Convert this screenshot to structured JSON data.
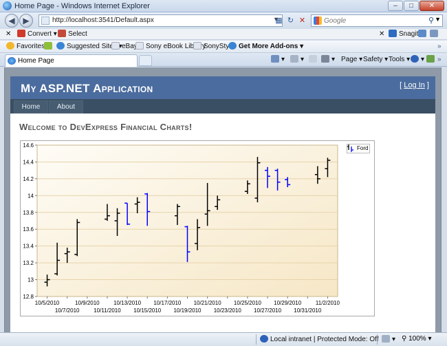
{
  "window": {
    "title": "Home Page - Windows Internet Explorer",
    "min_icon": "minimize-icon",
    "max_icon": "maximize-icon",
    "close_icon": "close-icon"
  },
  "nav": {
    "url": "http://localhost:3541/Default.aspx",
    "search_placeholder": "Google"
  },
  "command_bar": {
    "convert": "Convert",
    "select": "Select",
    "snagit": "Snagit"
  },
  "links_bar": {
    "favorites": "Favorites",
    "suggested_sites": "Suggested Sites",
    "ebay": "eBay",
    "sony_library": "Sony eBook Library",
    "sonystyle": "SonyStyle",
    "addons": "Get More Add-ons"
  },
  "tabs": {
    "active": "Home Page"
  },
  "toolbar": {
    "page": "Page",
    "safety": "Safety",
    "tools": "Tools"
  },
  "site": {
    "title": "My ASP.NET Application",
    "login_open": "[ ",
    "login_link": "Log In",
    "login_close": " ]",
    "menu": [
      "Home",
      "About"
    ],
    "welcome": "Welcome to DevExpress Financial Charts!"
  },
  "chart_data": {
    "type": "stock",
    "series": [
      {
        "name": "Ford",
        "color_up": "#000000",
        "color_down": "#0000ff"
      }
    ],
    "legend": "top-right",
    "ylim": [
      12.8,
      14.6
    ],
    "yticks": [
      "12.8",
      "13",
      "13.2",
      "13.4",
      "13.6",
      "13.8",
      "14",
      "14.2",
      "14.4",
      "14.6"
    ],
    "xlim": [
      "2010-10-04",
      "2010-11-03"
    ],
    "xticks_upper": [
      "10/5/2010",
      "10/9/2010",
      "10/13/2010",
      "10/17/2010",
      "10/21/2010",
      "10/25/2010",
      "10/29/2010",
      "11/2/2010"
    ],
    "xticks_lower": [
      "10/7/2010",
      "10/11/2010",
      "10/15/2010",
      "10/19/2010",
      "10/23/2010",
      "10/27/2010",
      "10/31/2010"
    ],
    "points": [
      {
        "date": "2010-10-05",
        "open": 12.97,
        "high": 13.06,
        "low": 12.92,
        "close": 13.0,
        "down": false
      },
      {
        "date": "2010-10-06",
        "open": 13.07,
        "high": 13.44,
        "low": 13.05,
        "close": 13.23,
        "down": false
      },
      {
        "date": "2010-10-07",
        "open": 13.31,
        "high": 13.38,
        "low": 13.2,
        "close": 13.33,
        "down": false
      },
      {
        "date": "2010-10-08",
        "open": 13.3,
        "high": 13.72,
        "low": 13.28,
        "close": 13.68,
        "down": false
      },
      {
        "date": "2010-10-11",
        "open": 13.72,
        "high": 13.9,
        "low": 13.7,
        "close": 13.76,
        "down": false
      },
      {
        "date": "2010-10-12",
        "open": 13.7,
        "high": 13.85,
        "low": 13.52,
        "close": 13.79,
        "down": false
      },
      {
        "date": "2010-10-13",
        "open": 13.91,
        "high": 13.91,
        "low": 13.65,
        "close": 13.66,
        "down": true
      },
      {
        "date": "2010-10-14",
        "open": 13.9,
        "high": 13.98,
        "low": 13.79,
        "close": 13.92,
        "down": false
      },
      {
        "date": "2010-10-15",
        "open": 14.02,
        "high": 14.03,
        "low": 13.64,
        "close": 13.81,
        "down": true
      },
      {
        "date": "2010-10-18",
        "open": 13.76,
        "high": 13.9,
        "low": 13.65,
        "close": 13.87,
        "down": false
      },
      {
        "date": "2010-10-19",
        "open": 13.63,
        "high": 13.64,
        "low": 13.21,
        "close": 13.33,
        "down": true
      },
      {
        "date": "2010-10-20",
        "open": 13.43,
        "high": 13.72,
        "low": 13.35,
        "close": 13.62,
        "down": false
      },
      {
        "date": "2010-10-21",
        "open": 13.78,
        "high": 14.15,
        "low": 13.64,
        "close": 13.82,
        "down": false
      },
      {
        "date": "2010-10-22",
        "open": 13.87,
        "high": 14.0,
        "low": 13.83,
        "close": 13.95,
        "down": false
      },
      {
        "date": "2010-10-25",
        "open": 14.05,
        "high": 14.18,
        "low": 14.02,
        "close": 14.14,
        "down": false
      },
      {
        "date": "2010-10-26",
        "open": 13.97,
        "high": 14.46,
        "low": 13.92,
        "close": 14.39,
        "down": false
      },
      {
        "date": "2010-10-27",
        "open": 14.3,
        "high": 14.34,
        "low": 14.09,
        "close": 14.23,
        "down": true
      },
      {
        "date": "2010-10-28",
        "open": 14.3,
        "high": 14.32,
        "low": 14.06,
        "close": 14.16,
        "down": true
      },
      {
        "date": "2010-10-29",
        "open": 14.19,
        "high": 14.22,
        "low": 14.1,
        "close": 14.13,
        "down": true
      },
      {
        "date": "2010-11-01",
        "open": 14.25,
        "high": 14.35,
        "low": 14.14,
        "close": 14.2,
        "down": false
      },
      {
        "date": "2010-11-02",
        "open": 14.32,
        "high": 14.45,
        "low": 14.22,
        "close": 14.42,
        "down": false
      }
    ]
  },
  "status": {
    "zone": "Local intranet | Protected Mode: Off",
    "zoom": "100%"
  }
}
